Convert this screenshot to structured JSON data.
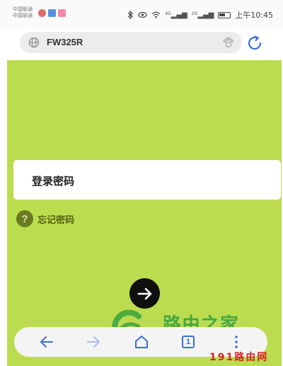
{
  "status_bar": {
    "carrier_1": "中国联通",
    "carrier_2": "中国联通",
    "network_1": "4G",
    "network_2": "2G",
    "time": "上午10:45",
    "battery_level": 0.45
  },
  "address_bar": {
    "url": "FW325R"
  },
  "login": {
    "password_label": "登录密码",
    "forgot_password": "忘记密码",
    "help_glyph": "?"
  },
  "toolbar": {
    "tab_count": "1"
  },
  "watermark": {
    "logo_text": "路由之家",
    "site_text": "191路由网"
  },
  "colors": {
    "background": "#bcdc50",
    "accent": "#3c6fd8",
    "login_button": "#101010"
  },
  "icons": [
    "globe-icon",
    "paw-icon",
    "refresh-icon",
    "help-icon",
    "arrow-right-icon",
    "back-arrow-icon",
    "forward-arrow-icon",
    "home-icon",
    "tabs-icon",
    "more-vertical-icon"
  ]
}
